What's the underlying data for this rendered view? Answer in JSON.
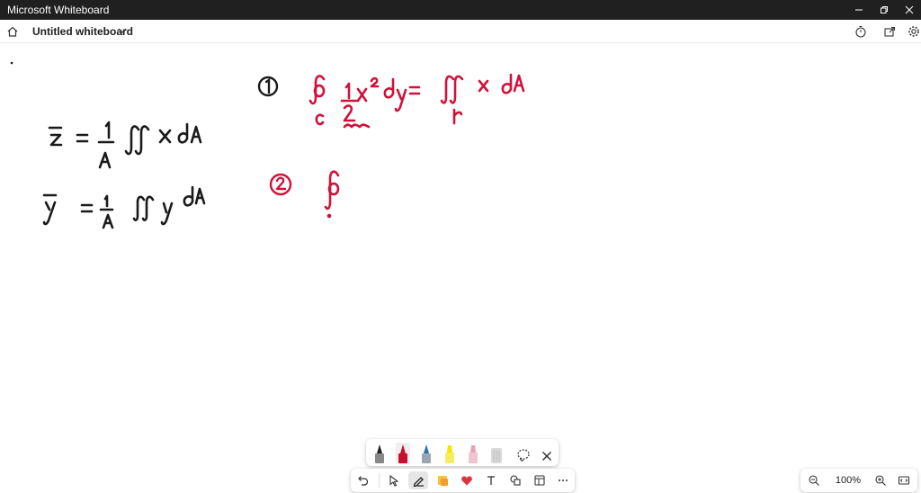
{
  "app": {
    "window_title": "Microsoft Whiteboard"
  },
  "header": {
    "board_name": "Untitled whiteboard"
  },
  "zoom": {
    "level": "100%"
  },
  "pen_tray": {
    "pens": [
      {
        "name": "black-pen",
        "color": "#1f1f1f"
      },
      {
        "name": "red-pen",
        "color": "#c8102e"
      },
      {
        "name": "blue-pen",
        "color": "#2a6fb0"
      },
      {
        "name": "yellow-highlighter",
        "color": "#f5e600"
      },
      {
        "name": "pink-highlighter",
        "color": "#e8a0b4"
      },
      {
        "name": "eraser",
        "color": "#d9d9d9"
      }
    ]
  },
  "ink_colors": {
    "black": "#1a1a1a",
    "red": "#d0123a"
  },
  "canvas": {
    "label_circle_1": "1",
    "label_circle_2": "2"
  }
}
